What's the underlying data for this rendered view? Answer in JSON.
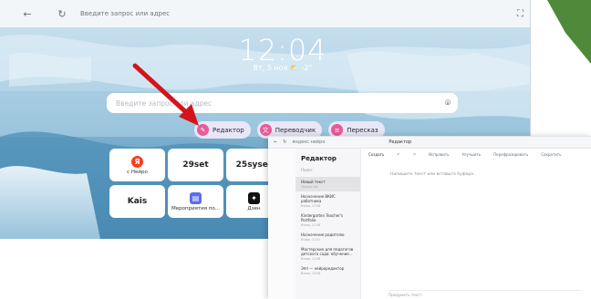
{
  "browser": {
    "address_placeholder": "Введите запрос или адрес",
    "nav_back": "←",
    "nav_refresh": "↻",
    "time": "12:04",
    "date_weather": "Вт, 5 ноя ⛅ -2°",
    "search_placeholder": "Введите запрос или адрес",
    "chips": [
      {
        "label": "Редактор",
        "icon": "pencil-icon"
      },
      {
        "label": "Переводчик",
        "icon": "translate-icon"
      },
      {
        "label": "Пересказ",
        "icon": "summary-icon"
      }
    ],
    "tiles": [
      {
        "big": "Я",
        "small": "с Нейро",
        "icon": "yandex-icon",
        "color": "#fc3f1d"
      },
      {
        "big": "29set",
        "small": ""
      },
      {
        "big": "25syser",
        "small": ""
      },
      {
        "big": "Kais",
        "small": ""
      },
      {
        "big": "",
        "small": "Мероприятия по...",
        "icon": "calendar-icon",
        "color": "#5b6df0"
      },
      {
        "big": "",
        "small": "Дзен",
        "icon": "dzen-icon",
        "color": "#111111"
      }
    ]
  },
  "editor": {
    "url": "яндекс нейро",
    "title": "Редактор",
    "sidebar_title": "Редактор",
    "search_label": "Поиск",
    "documents": [
      {
        "title": "Новый текст",
        "date": "Только что"
      },
      {
        "title": "Назначение ВКИС работника",
        "date": "Вчера, 17:08"
      },
      {
        "title": "Kindergarten Teacher's Portfolio",
        "date": "Вчера, 22:48"
      },
      {
        "title": "Назначение родителю",
        "date": "Вчера, 11:51"
      },
      {
        "title": "Мастерские для педагогов детского сада: обучение...",
        "date": "Вчера, 11:08"
      },
      {
        "title": "Эпп — нейроредактор",
        "date": "Вчера, 13:56"
      }
    ],
    "toolbar": [
      "Создать",
      "↶",
      "↷",
      "Исправить",
      "Улучшить",
      "Перефразировать",
      "Сократить"
    ],
    "hint": "Напишите текст или вставьте буфера",
    "input_placeholder": "Придумать текст"
  },
  "colors": {
    "chip_dot": "#e85a9b",
    "arrow": "#d4141c",
    "corner_green": "#4f8a3a"
  }
}
